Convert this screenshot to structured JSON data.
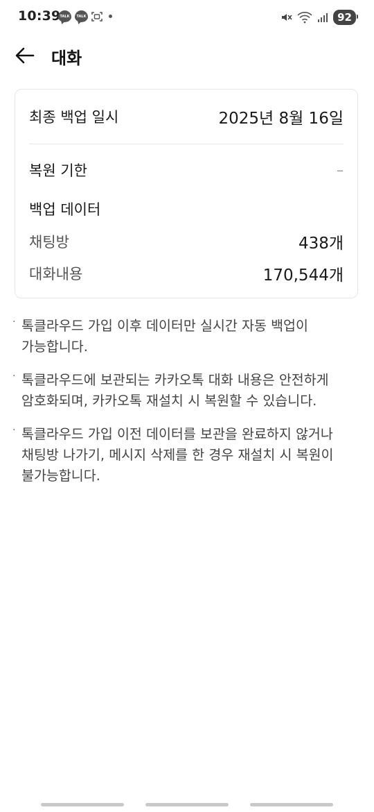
{
  "status_bar": {
    "time": "10:39",
    "notifications": [
      "talk-icon",
      "talk-icon",
      "screenshot-icon",
      "dot-icon"
    ],
    "talk_label": "TALK",
    "battery": "92"
  },
  "appbar": {
    "title": "대화"
  },
  "backup_card": {
    "last_backup_label": "최종 백업 일시",
    "last_backup_value": "2025년 8월 16일",
    "restore_deadline_label": "복원 기한",
    "restore_deadline_value": "–",
    "backup_data_label": "백업 데이터",
    "chatrooms_label": "채팅방",
    "chatrooms_value": "438개",
    "messages_label": "대화내용",
    "messages_value": "170,544개"
  },
  "notes": [
    "톡클라우드 가입 이후 데이터만 실시간 자동 백업이 가능합니다.",
    "톡클라우드에 보관되는 카카오톡 대화 내용은 안전하게 암호화되며, 카카오톡 재설치 시 복원할 수 있습니다.",
    "톡클라우드 가입 이전 데이터를 보관을 완료하지 않거나 채팅방 나가기, 메시지 삭제를 한 경우 재설치 시 복원이 불가능합니다."
  ],
  "bullet": "·"
}
